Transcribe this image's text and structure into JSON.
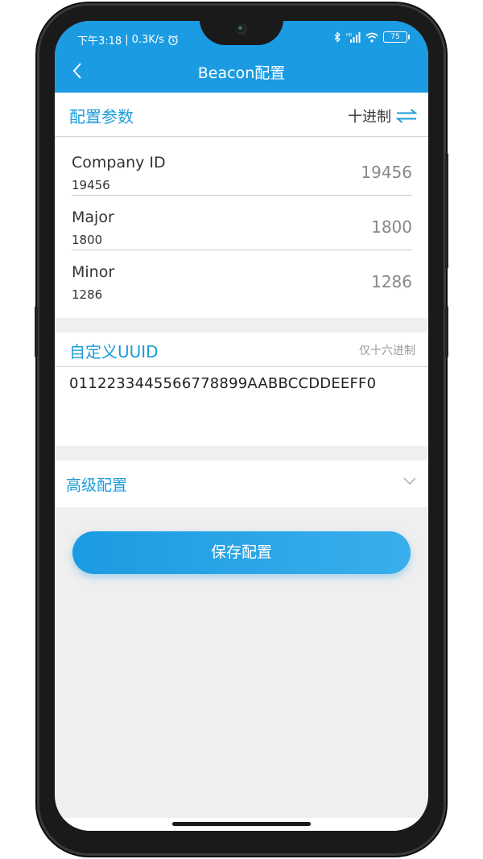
{
  "status_bar": {
    "time": "下午3:18",
    "speed": "0.3K/s",
    "battery": "75"
  },
  "header": {
    "title": "Beacon配置"
  },
  "params": {
    "section_title": "配置参数",
    "radix_label": "十进制",
    "rows": [
      {
        "name": "Company ID",
        "value": "19456",
        "input": "19456"
      },
      {
        "name": "Major",
        "value": "1800",
        "input": "1800"
      },
      {
        "name": "Minor",
        "value": "1286",
        "input": "1286"
      }
    ]
  },
  "uuid": {
    "section_title": "自定义UUID",
    "hint": "仅十六进制",
    "value": "0112233445566778899AABBCCDDEEFF0"
  },
  "advanced": {
    "label": "高级配置"
  },
  "actions": {
    "save_label": "保存配置"
  },
  "colors": {
    "accent": "#1b9be2",
    "background": "#efefef"
  }
}
